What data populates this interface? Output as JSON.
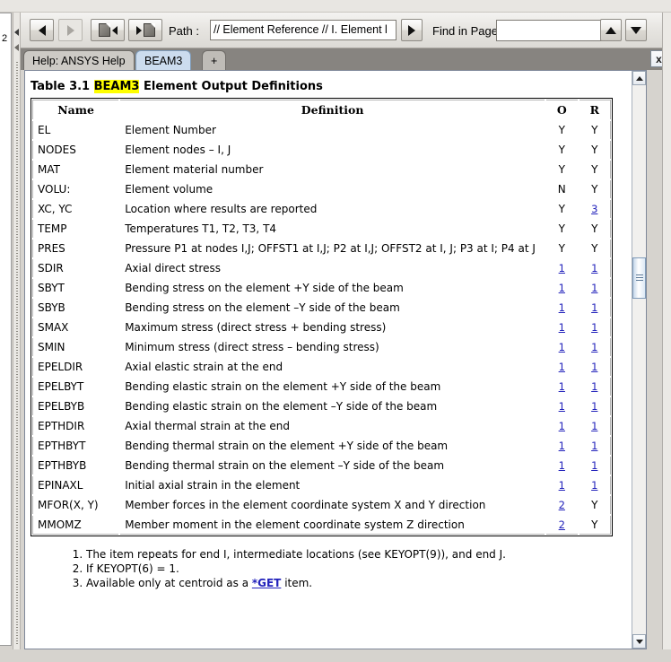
{
  "window": {
    "left_strip_label": "2"
  },
  "toolbar": {
    "back_tooltip": "Back",
    "forward_tooltip": "Forward",
    "prev_page_tooltip": "Previous Page",
    "next_page_tooltip": "Next Page",
    "path_label": "Path :",
    "path_value": "// Element Reference // I. Element l",
    "path_placeholder": "",
    "go_tooltip": "Go",
    "find_label": "Find in Page:",
    "find_value": "",
    "find_placeholder": "",
    "find_up_tooltip": "Find Previous",
    "find_down_tooltip": "Find Next"
  },
  "tabs": {
    "items": [
      {
        "label": "Help: ANSYS Help",
        "active": false
      },
      {
        "label": "BEAM3",
        "active": true
      },
      {
        "label": "+",
        "active": false
      }
    ],
    "close_label": "x"
  },
  "document": {
    "caption_prefix": "Table 3.1",
    "caption_highlight": "BEAM3",
    "caption_suffix": "Element Output Definitions",
    "columns": [
      "Name",
      "Definition",
      "O",
      "R"
    ],
    "rows": [
      {
        "name": "EL",
        "definition": "Element Number",
        "o": "Y",
        "o_link": false,
        "r": "Y",
        "r_link": false
      },
      {
        "name": "NODES",
        "definition": "Element nodes – I, J",
        "o": "Y",
        "o_link": false,
        "r": "Y",
        "r_link": false
      },
      {
        "name": "MAT",
        "definition": "Element material number",
        "o": "Y",
        "o_link": false,
        "r": "Y",
        "r_link": false
      },
      {
        "name": "VOLU:",
        "definition": "Element volume",
        "o": "N",
        "o_link": false,
        "r": "Y",
        "r_link": false
      },
      {
        "name": "XC, YC",
        "definition": "Location where results are reported",
        "o": "Y",
        "o_link": false,
        "r": "3",
        "r_link": true
      },
      {
        "name": "TEMP",
        "definition": "Temperatures T1, T2, T3, T4",
        "o": "Y",
        "o_link": false,
        "r": "Y",
        "r_link": false
      },
      {
        "name": "PRES",
        "definition": "Pressure P1 at nodes I,J; OFFST1 at I,J; P2 at I,J; OFFST2 at I, J; P3 at I; P4 at J",
        "o": "Y",
        "o_link": false,
        "r": "Y",
        "r_link": false
      },
      {
        "name": "SDIR",
        "definition": "Axial direct stress",
        "o": "1",
        "o_link": true,
        "r": "1",
        "r_link": true
      },
      {
        "name": "SBYT",
        "definition": "Bending stress on the element +Y side of the beam",
        "o": "1",
        "o_link": true,
        "r": "1",
        "r_link": true
      },
      {
        "name": "SBYB",
        "definition": "Bending stress on the element –Y side of the beam",
        "o": "1",
        "o_link": true,
        "r": "1",
        "r_link": true
      },
      {
        "name": "SMAX",
        "definition": "Maximum stress (direct stress + bending stress)",
        "o": "1",
        "o_link": true,
        "r": "1",
        "r_link": true
      },
      {
        "name": "SMIN",
        "definition": "Minimum stress (direct stress – bending stress)",
        "o": "1",
        "o_link": true,
        "r": "1",
        "r_link": true
      },
      {
        "name": "EPELDIR",
        "definition": "Axial elastic strain at the end",
        "o": "1",
        "o_link": true,
        "r": "1",
        "r_link": true
      },
      {
        "name": "EPELBYT",
        "definition": "Bending elastic strain on the element +Y side of the beam",
        "o": "1",
        "o_link": true,
        "r": "1",
        "r_link": true
      },
      {
        "name": "EPELBYB",
        "definition": "Bending elastic strain on the element –Y side of the beam",
        "o": "1",
        "o_link": true,
        "r": "1",
        "r_link": true
      },
      {
        "name": "EPTHDIR",
        "definition": "Axial thermal strain at the end",
        "o": "1",
        "o_link": true,
        "r": "1",
        "r_link": true
      },
      {
        "name": "EPTHBYT",
        "definition": "Bending thermal strain on the element +Y side of the beam",
        "o": "1",
        "o_link": true,
        "r": "1",
        "r_link": true
      },
      {
        "name": "EPTHBYB",
        "definition": "Bending thermal strain on the element –Y side of the beam",
        "o": "1",
        "o_link": true,
        "r": "1",
        "r_link": true
      },
      {
        "name": "EPINAXL",
        "definition": "Initial axial strain in the element",
        "o": "1",
        "o_link": true,
        "r": "1",
        "r_link": true
      },
      {
        "name": "MFOR(X, Y)",
        "definition": "Member forces in the element coordinate system X and Y direction",
        "o": "2",
        "o_link": true,
        "r": "Y",
        "r_link": false
      },
      {
        "name": "MMOMZ",
        "definition": "Member moment in the element coordinate system Z direction",
        "o": "2",
        "o_link": true,
        "r": "Y",
        "r_link": false
      }
    ],
    "footnotes": [
      {
        "pre": "The item repeats for end I, intermediate locations (see KEYOPT(9)), and end J.",
        "link": "",
        "post": ""
      },
      {
        "pre": "If KEYOPT(6) = 1.",
        "link": "",
        "post": ""
      },
      {
        "pre": "Available only at centroid as a ",
        "link": "*GET",
        "post": " item."
      }
    ]
  },
  "colors": {
    "link": "#2222bb",
    "highlight": "#ffff00",
    "active_tab": "#ccdcee",
    "tabbar": "#878480"
  }
}
